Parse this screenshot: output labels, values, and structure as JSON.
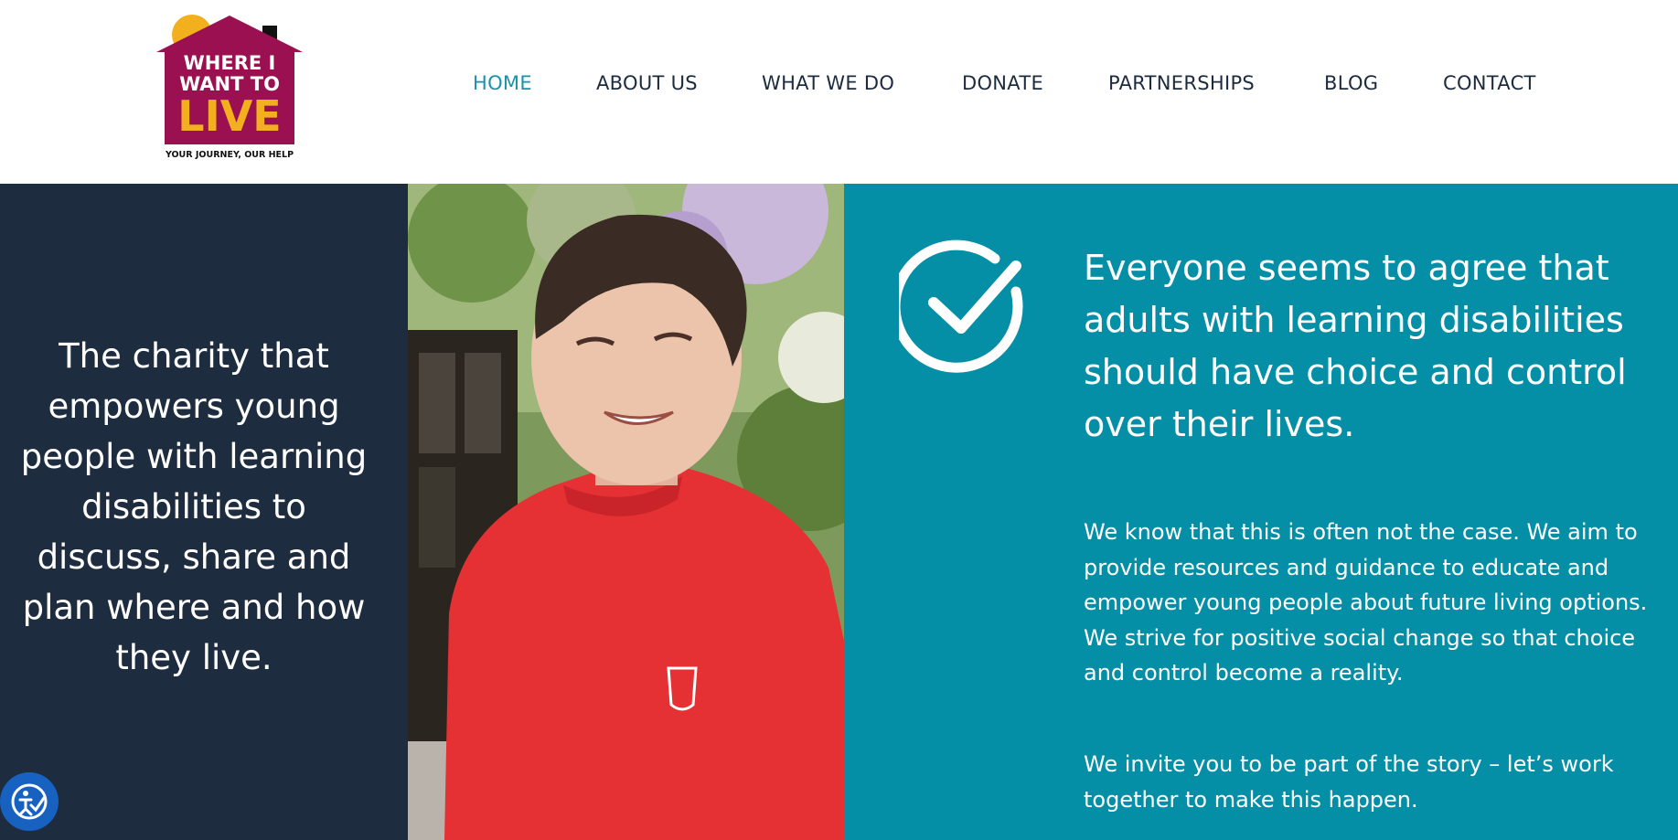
{
  "logo": {
    "line1": "WHERE I",
    "line2": "WANT TO",
    "line3": "LIVE",
    "tagline": "YOUR JOURNEY, OUR HELP"
  },
  "nav": {
    "items": [
      {
        "label": "HOME",
        "active": true
      },
      {
        "label": "ABOUT US",
        "active": false
      },
      {
        "label": "WHAT WE DO",
        "active": false
      },
      {
        "label": "DONATE",
        "active": false
      },
      {
        "label": "PARTNERSHIPS",
        "active": false
      },
      {
        "label": "BLOG",
        "active": false
      },
      {
        "label": "CONTACT",
        "active": false
      }
    ]
  },
  "hero": {
    "tagline": "The charity that empowers young people with learning disabilities to discuss, share and plan where and how they live.",
    "headline": "Everyone seems to agree that adults with learning disabilities should have choice and control over their lives.",
    "body_1": "We know that this is often not the case. We aim to provide resources and guidance to educate and empower young people about future living options. We strive for positive social change so that choice and control become a reality.",
    "body_2": "We invite you to be part of the story – let’s work together to make this happen."
  },
  "icons": {
    "hero_icon": "check-circle-icon",
    "accessibility": "accessibility-icon"
  },
  "colors": {
    "dark_panel": "#1e2c3f",
    "teal_panel": "#058fa7",
    "nav_active": "#1a93a8",
    "nav_text": "#1d2b3e",
    "logo_house": "#9b1050",
    "logo_accent": "#f2b01e",
    "accessibility_button": "#1762c0"
  }
}
